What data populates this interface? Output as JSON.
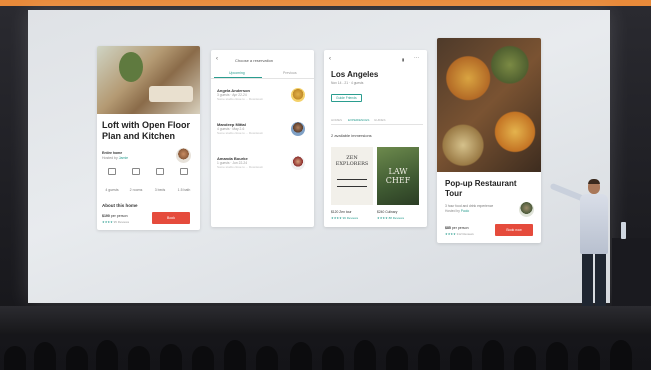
{
  "listing": {
    "title": "Loft with Open Floor Plan and Kitchen",
    "entire_home": "Entire home",
    "hosted_prefix": "Hosted by",
    "host_name": "Jamie",
    "features": [
      {
        "icon": "guests-icon",
        "label": "4 guests"
      },
      {
        "icon": "rooms-icon",
        "label": "2 rooms"
      },
      {
        "icon": "beds-icon",
        "label": "3 beds"
      },
      {
        "icon": "bath-icon",
        "label": "1.5 bath"
      }
    ],
    "about_heading": "About this home",
    "price": "$190",
    "price_unit": "per person",
    "rating_stars": "★★★★",
    "reviews": "95 Reviews",
    "book_label": "Book"
  },
  "reservation": {
    "header": "Choose a reservation",
    "tabs": [
      "Upcoming",
      "Previous"
    ],
    "items": [
      {
        "name": "Angela Anderson",
        "sub": "3 guests · Apr 22-24",
        "note": "Some studio close to ... Downtown"
      },
      {
        "name": "Mandeep Mittal",
        "sub": "4 guests · May 2-6",
        "note": "Some studio close to ... Downtown"
      },
      {
        "name": "Amanda Bourke",
        "sub": "1 guests · Jun 22-24",
        "note": "Some studio close to ... Downtown"
      }
    ]
  },
  "city": {
    "name": "Los Angeles",
    "dates": "Nov 14 - 21 · 4 guests",
    "chip": "Guide Friends",
    "tabs": [
      "HOMES",
      "EXPERIENCES",
      "GUIDES"
    ],
    "available": "2 available immersions",
    "books": [
      {
        "title": "ZEN EXPLORERS",
        "price": "$120 Zen tour",
        "stars": "★★★★ 96 Reviews"
      },
      {
        "title": "LAW CHEF",
        "price": "$240 Culinary",
        "stars": "★★★★ 88 Reviews"
      }
    ]
  },
  "experience": {
    "title": "Pop-up Restaurant Tour",
    "sub": "3 hour food and drink experience",
    "hosted_prefix": "Hosted by",
    "host_name": "Paolo",
    "price": "$85",
    "price_unit": "per person",
    "rating_stars": "★★★★",
    "reviews": "312 Reviews",
    "book_label": "Book now"
  },
  "colors": {
    "accent_teal": "#2a9d8f",
    "book_red": "#e54b3c",
    "top_strip": "#e88a3a"
  }
}
